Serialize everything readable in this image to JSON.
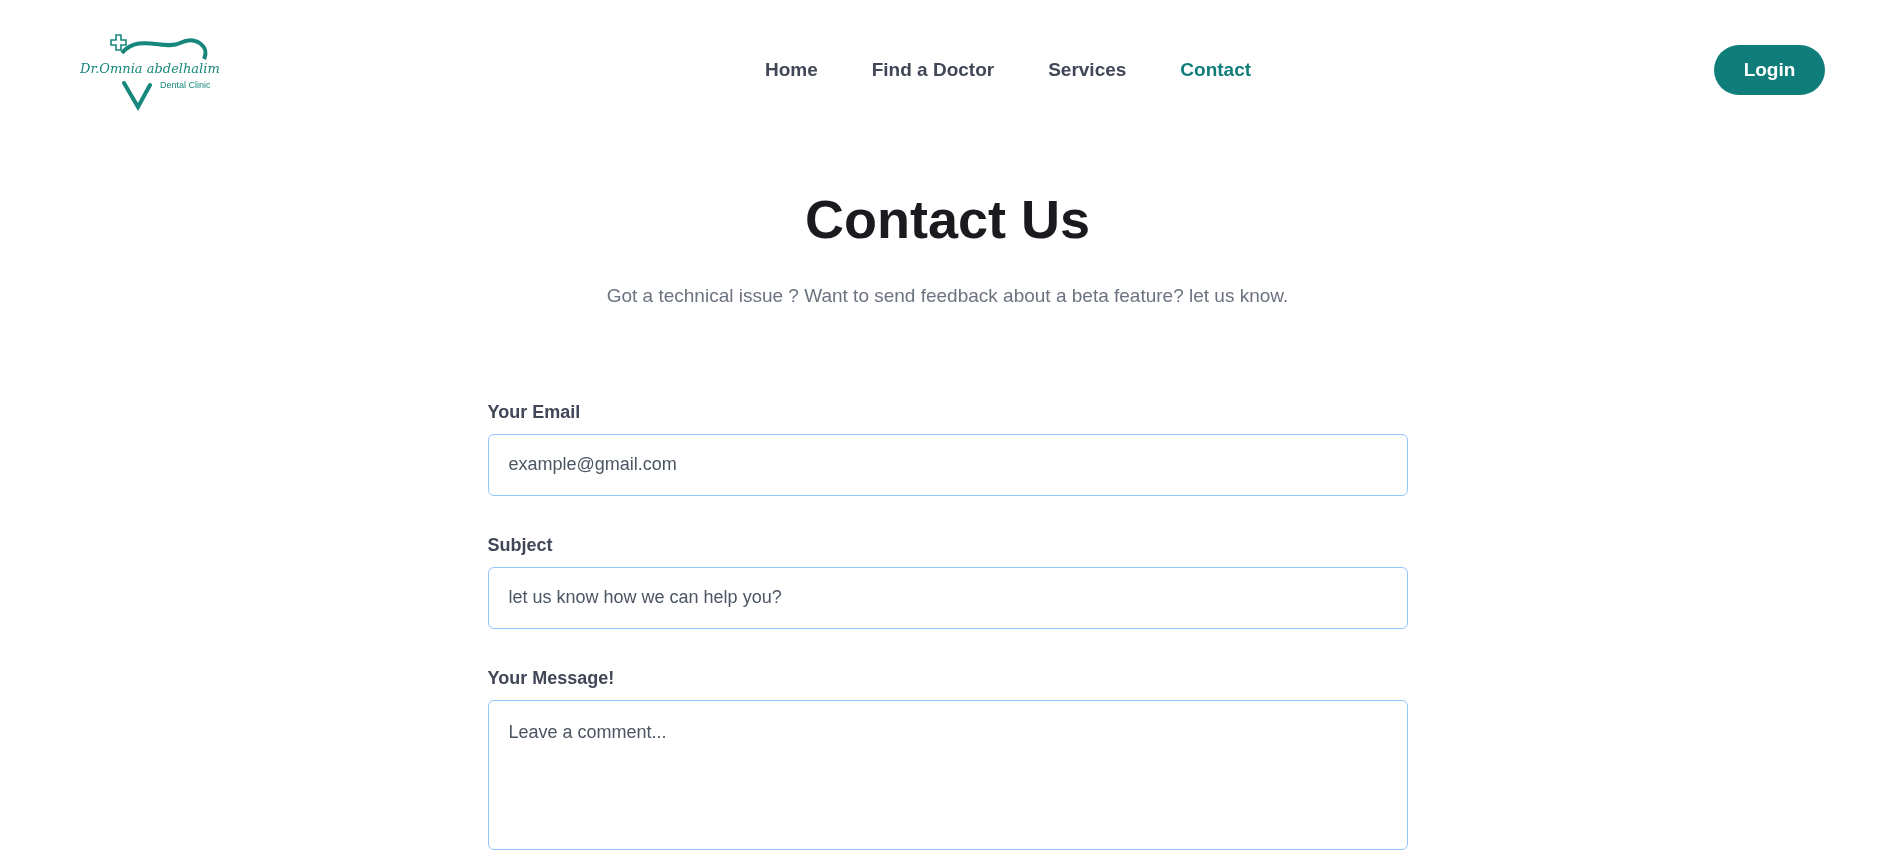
{
  "logo": {
    "name": "Dr.Omnia abdelhalim",
    "tagline": "Dental Clinic"
  },
  "nav": [
    {
      "label": "Home",
      "selected": false
    },
    {
      "label": "Find a Doctor",
      "selected": false
    },
    {
      "label": "Services",
      "selected": false
    },
    {
      "label": "Contact",
      "selected": true
    }
  ],
  "login_button": "Login",
  "heading": "Contact Us",
  "subtitle": "Got a technical issue ? Want to send feedback about a beta feature? let us know.",
  "form": [
    {
      "kind": "input",
      "label": "Your Email",
      "placeholder": "example@gmail.com"
    },
    {
      "kind": "input",
      "label": "Subject",
      "placeholder": "let us know how we can help you?"
    },
    {
      "kind": "textarea",
      "label": "Your Message!",
      "placeholder": "Leave a comment..."
    }
  ]
}
